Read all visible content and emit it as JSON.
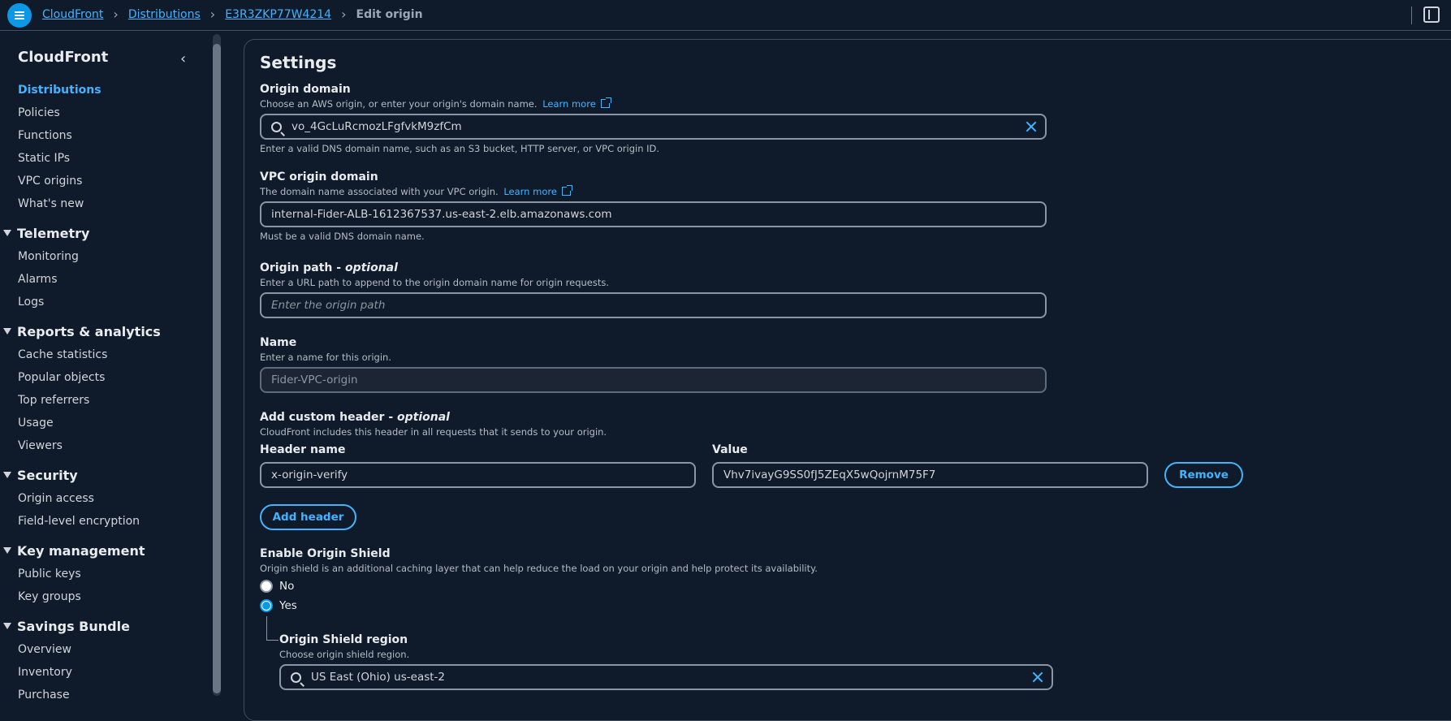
{
  "topbar": {
    "menu_icon": "hamburger-menu-icon",
    "breadcrumbs": [
      "CloudFront",
      "Distributions",
      "E3R3ZKP77W4214"
    ],
    "current": "Edit origin",
    "right_icon": "panel-toggle-icon"
  },
  "sidebar": {
    "title": "CloudFront",
    "collapse_icon": "chevron-left-icon",
    "items": [
      "Distributions",
      "Policies",
      "Functions",
      "Static IPs",
      "VPC origins",
      "What's new"
    ],
    "sections": [
      {
        "title": "Telemetry",
        "items": [
          "Monitoring",
          "Alarms",
          "Logs"
        ]
      },
      {
        "title": "Reports & analytics",
        "items": [
          "Cache statistics",
          "Popular objects",
          "Top referrers",
          "Usage",
          "Viewers"
        ]
      },
      {
        "title": "Security",
        "items": [
          "Origin access",
          "Field-level encryption"
        ]
      },
      {
        "title": "Key management",
        "items": [
          "Public keys",
          "Key groups"
        ]
      },
      {
        "title": "Savings Bundle",
        "items": [
          "Overview",
          "Inventory",
          "Purchase"
        ]
      }
    ]
  },
  "settings": {
    "heading": "Settings",
    "origin_domain": {
      "label": "Origin domain",
      "description": "Choose an AWS origin, or enter your origin's domain name.",
      "learn_more": "Learn more",
      "value": "vo_4GcLuRcmozLFgfvkM9zfCm",
      "hint": "Enter a valid DNS domain name, such as an S3 bucket, HTTP server, or VPC origin ID."
    },
    "vpc_origin_domain": {
      "label": "VPC origin domain",
      "description": "The domain name associated with your VPC origin.",
      "learn_more": "Learn more",
      "value": "internal-Fider-ALB-1612367537.us-east-2.elb.amazonaws.com",
      "hint": "Must be a valid DNS domain name."
    },
    "origin_path": {
      "label": "Origin path - ",
      "label_optional": "optional",
      "description": "Enter a URL path to append to the origin domain name for origin requests.",
      "placeholder": "Enter the origin path"
    },
    "name": {
      "label": "Name",
      "description": "Enter a name for this origin.",
      "value": "Fider-VPC-origin"
    },
    "custom_header": {
      "label": "Add custom header - ",
      "label_optional": "optional",
      "description": "CloudFront includes this header in all requests that it sends to your origin.",
      "header_name_label": "Header name",
      "value_label": "Value",
      "header_name": "x-origin-verify",
      "header_value": "Vhv7ivayG9SS0fJ5ZEqX5wQojrnM75F7",
      "remove_label": "Remove",
      "add_label": "Add header"
    },
    "origin_shield": {
      "label": "Enable Origin Shield",
      "description": "Origin shield is an additional caching layer that can help reduce the load on your origin and help protect its availability.",
      "options": [
        "No",
        "Yes"
      ],
      "selected": "Yes",
      "region_label": "Origin Shield region",
      "region_description": "Choose origin shield region.",
      "region_value": "US East (Ohio) us-east-2"
    }
  }
}
